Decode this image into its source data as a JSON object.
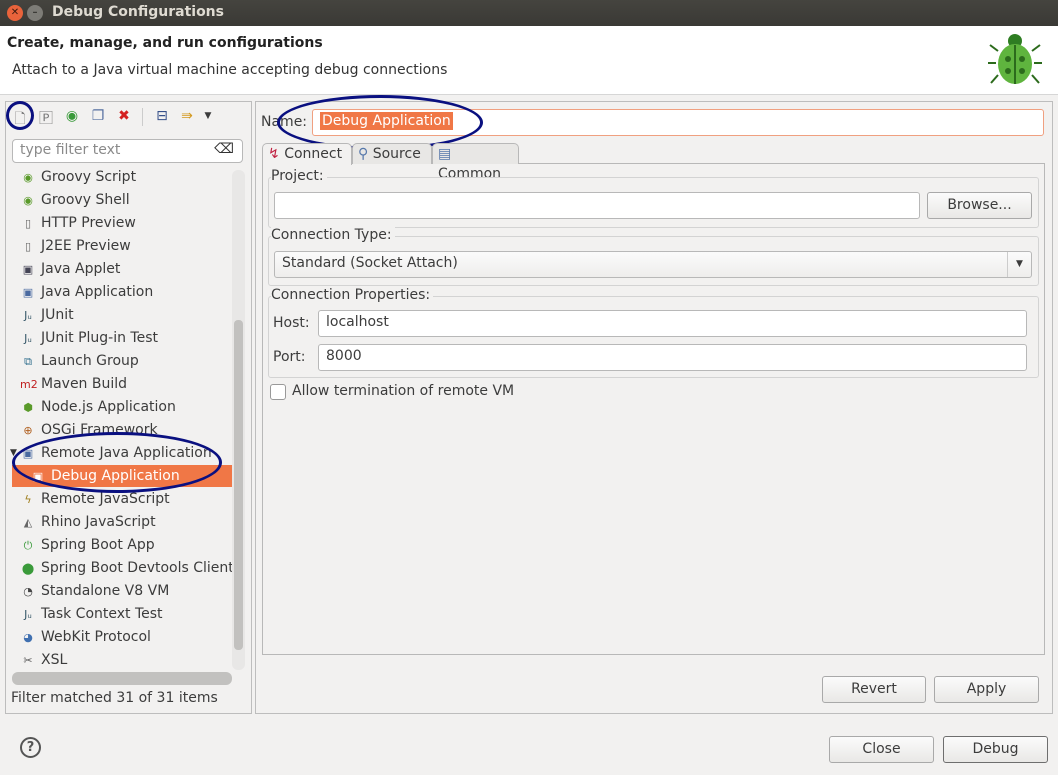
{
  "window": {
    "title": "Debug Configurations"
  },
  "header": {
    "title": "Create, manage, and run configurations",
    "subtitle": "Attach to a Java virtual machine accepting debug connections"
  },
  "left": {
    "filter_placeholder": "type filter text",
    "items": [
      {
        "label": "Groovy Script",
        "icon": "groovy-icon"
      },
      {
        "label": "Groovy Shell",
        "icon": "groovy-icon"
      },
      {
        "label": "HTTP Preview",
        "icon": "server-icon"
      },
      {
        "label": "J2EE Preview",
        "icon": "server-icon"
      },
      {
        "label": "Java Applet",
        "icon": "applet-icon"
      },
      {
        "label": "Java Application",
        "icon": "java-app-icon"
      },
      {
        "label": "JUnit",
        "icon": "junit-icon"
      },
      {
        "label": "JUnit Plug-in Test",
        "icon": "junit-plugin-icon"
      },
      {
        "label": "Launch Group",
        "icon": "launch-group-icon"
      },
      {
        "label": "Maven Build",
        "icon": "maven-icon"
      },
      {
        "label": "Node.js Application",
        "icon": "nodejs-icon"
      },
      {
        "label": "OSGi Framework",
        "icon": "osgi-icon"
      },
      {
        "label": "Remote Java Application",
        "icon": "remote-java-icon"
      },
      {
        "label": "Debug Application",
        "icon": "remote-java-icon"
      },
      {
        "label": "Remote JavaScript",
        "icon": "remote-js-icon"
      },
      {
        "label": "Rhino JavaScript",
        "icon": "rhino-icon"
      },
      {
        "label": "Spring Boot App",
        "icon": "spring-icon"
      },
      {
        "label": "Spring Boot Devtools Client",
        "icon": "spring-devtools-icon"
      },
      {
        "label": "Standalone V8 VM",
        "icon": "v8-icon"
      },
      {
        "label": "Task Context Test",
        "icon": "junit-icon"
      },
      {
        "label": "WebKit Protocol",
        "icon": "webkit-icon"
      },
      {
        "label": "XSL",
        "icon": "xsl-icon"
      }
    ],
    "status": "Filter matched 31 of 31 items"
  },
  "right": {
    "name_label": "Name:",
    "name_value": "Debug Application",
    "tabs": [
      "Connect",
      "Source",
      "Common"
    ],
    "project_label": "Project:",
    "project_value": "",
    "browse": "Browse...",
    "conn_type_label": "Connection Type:",
    "conn_type_value": "Standard (Socket Attach)",
    "conn_props_label": "Connection Properties:",
    "host_label": "Host:",
    "host_value": "localhost",
    "port_label": "Port:",
    "port_value": "8000",
    "allow_termination": "Allow termination of remote VM",
    "allow_termination_checked": false,
    "revert": "Revert",
    "apply": "Apply"
  },
  "footer": {
    "close": "Close",
    "debug": "Debug"
  },
  "colors": {
    "selection": "#f07746",
    "annotation": "#0a1080"
  }
}
